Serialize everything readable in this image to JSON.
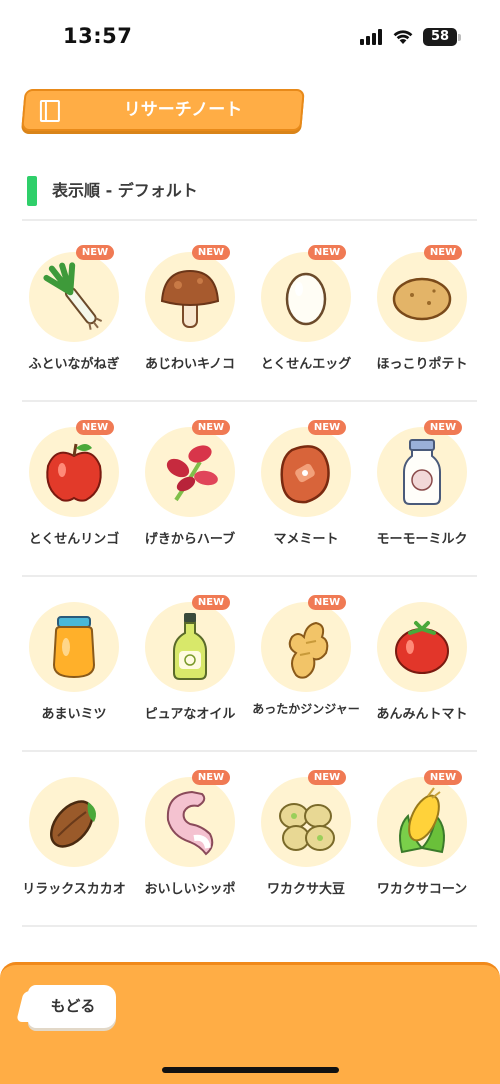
{
  "status_bar": {
    "time": "13:57",
    "battery": "58"
  },
  "header": {
    "title": "リサーチノート",
    "icon": "notebook-icon"
  },
  "sort": {
    "label": "表示順 - デフォルト",
    "accent_color": "#2fcf6a"
  },
  "badge_text": "NEW",
  "items": [
    {
      "name": "ふといながねぎ",
      "icon": "leek-icon",
      "is_new": true
    },
    {
      "name": "あじわいキノコ",
      "icon": "mushroom-icon",
      "is_new": true
    },
    {
      "name": "とくせんエッグ",
      "icon": "egg-icon",
      "is_new": true
    },
    {
      "name": "ほっこりポテト",
      "icon": "potato-icon",
      "is_new": true
    },
    {
      "name": "とくせんリンゴ",
      "icon": "apple-icon",
      "is_new": true
    },
    {
      "name": "げきからハーブ",
      "icon": "herb-icon",
      "is_new": true
    },
    {
      "name": "マメミート",
      "icon": "bean-meat-icon",
      "is_new": true
    },
    {
      "name": "モーモーミルク",
      "icon": "milk-icon",
      "is_new": true
    },
    {
      "name": "あまいミツ",
      "icon": "honey-icon",
      "is_new": false
    },
    {
      "name": "ピュアなオイル",
      "icon": "oil-icon",
      "is_new": true
    },
    {
      "name": "あったかジンジャー",
      "icon": "ginger-icon",
      "is_new": true
    },
    {
      "name": "あんみんトマト",
      "icon": "tomato-icon",
      "is_new": false
    },
    {
      "name": "リラックスカカオ",
      "icon": "cacao-icon",
      "is_new": false
    },
    {
      "name": "おいしいシッポ",
      "icon": "tail-icon",
      "is_new": true
    },
    {
      "name": "ワカクサ大豆",
      "icon": "soybean-icon",
      "is_new": true
    },
    {
      "name": "ワカクサコーン",
      "icon": "corn-icon",
      "is_new": true
    }
  ],
  "footer": {
    "back_label": "もどる"
  },
  "colors": {
    "accent": "#ffad45",
    "badge": "#f07a54",
    "item_bg": "#fff3d1"
  }
}
